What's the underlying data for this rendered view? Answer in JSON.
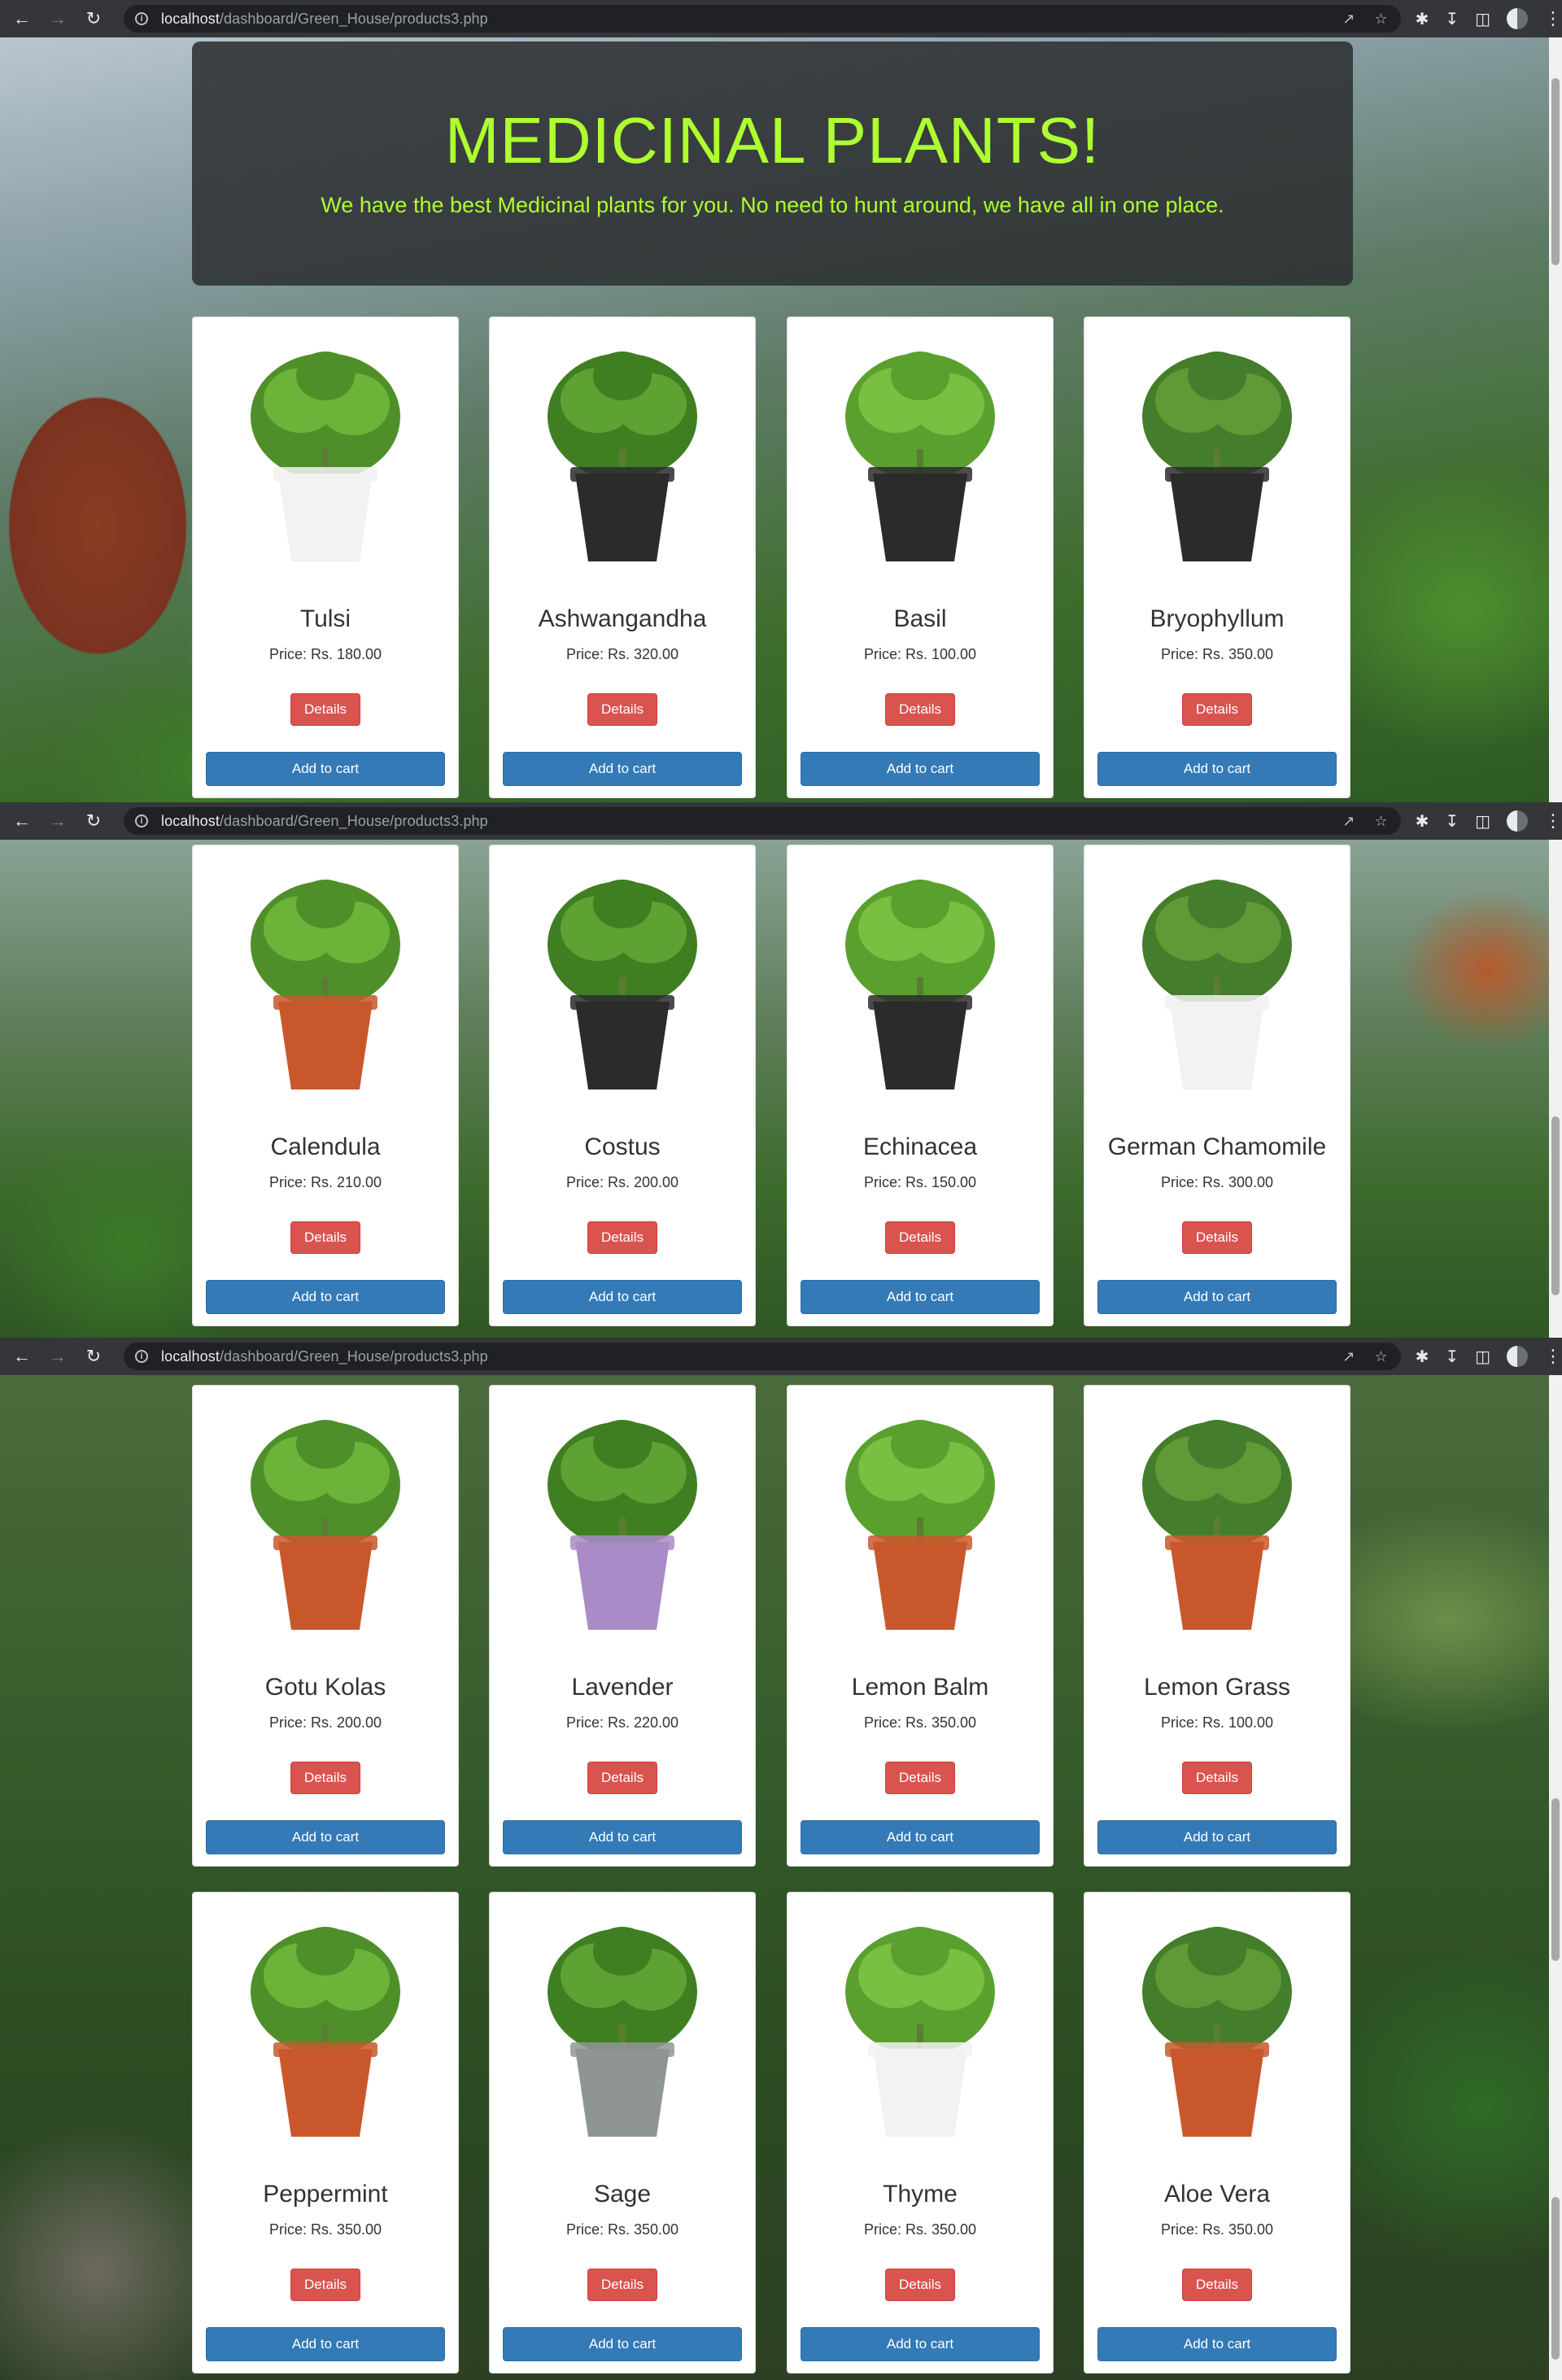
{
  "browser": {
    "url_host": "localhost",
    "url_path": "/dashboard/Green_House/products3.php",
    "back_icon": "back-arrow-icon",
    "forward_icon": "forward-arrow-icon",
    "reload_icon": "reload-icon"
  },
  "header": {
    "title": "MEDICINAL PLANTS!",
    "subtitle": "We have the best Medicinal plants for you. No need to hunt around, we have all in one place."
  },
  "colors": {
    "title": "#adff2f",
    "details_button": "#d9534f",
    "cart_button": "#337ab7"
  },
  "labels": {
    "details": "Details",
    "add_to_cart": "Add to cart"
  },
  "products": [
    {
      "name": "Tulsi",
      "price": "Price: Rs. 180.00",
      "pot": "white"
    },
    {
      "name": "Ashwangandha",
      "price": "Price: Rs. 320.00",
      "pot": "black"
    },
    {
      "name": "Basil",
      "price": "Price: Rs. 100.00",
      "pot": "black"
    },
    {
      "name": "Bryophyllum",
      "price": "Price: Rs. 350.00",
      "pot": "black"
    },
    {
      "name": "Calendula",
      "price": "Price: Rs. 210.00",
      "pot": "terracotta"
    },
    {
      "name": "Costus",
      "price": "Price: Rs. 200.00",
      "pot": "black"
    },
    {
      "name": "Echinacea",
      "price": "Price: Rs. 150.00",
      "pot": "black"
    },
    {
      "name": "German Chamomile",
      "price": "Price: Rs. 300.00",
      "pot": "white"
    },
    {
      "name": "Gotu Kolas",
      "price": "Price: Rs. 200.00",
      "pot": "terracotta"
    },
    {
      "name": "Lavender",
      "price": "Price: Rs. 220.00",
      "pot": "purple"
    },
    {
      "name": "Lemon Balm",
      "price": "Price: Rs. 350.00",
      "pot": "terracotta"
    },
    {
      "name": "Lemon Grass",
      "price": "Price: Rs. 100.00",
      "pot": "terracotta"
    },
    {
      "name": "Peppermint",
      "price": "Price: Rs. 350.00",
      "pot": "terracotta"
    },
    {
      "name": "Sage",
      "price": "Price: Rs. 350.00",
      "pot": "grey"
    },
    {
      "name": "Thyme",
      "price": "Price: Rs. 350.00",
      "pot": "white"
    },
    {
      "name": "Aloe Vera",
      "price": "Price: Rs. 350.00",
      "pot": "terracotta"
    }
  ]
}
